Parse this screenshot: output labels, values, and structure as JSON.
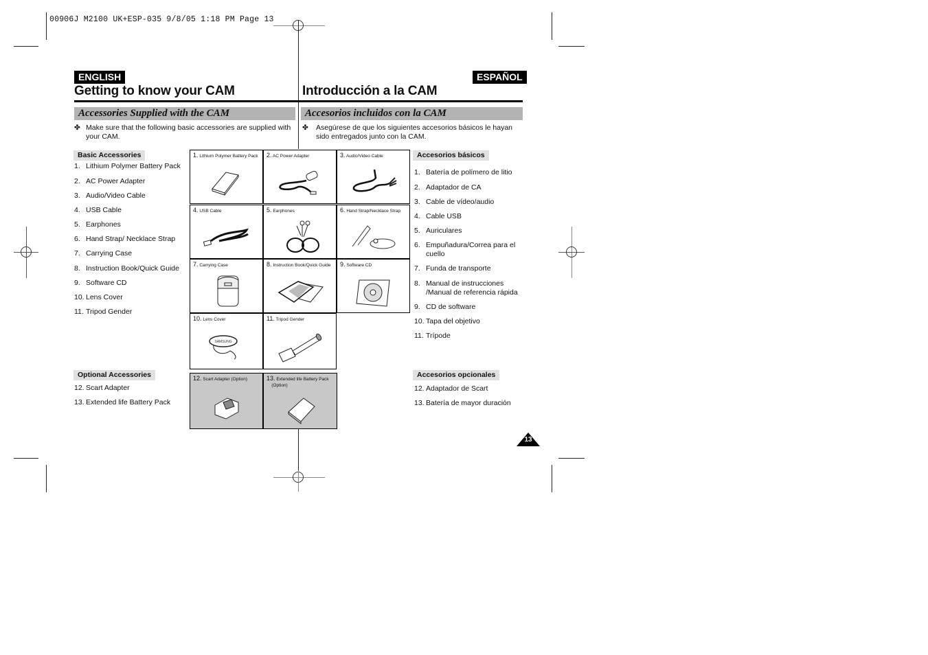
{
  "slug": "00906J M2100 UK+ESP-035  9/8/05 1:18 PM  Page 13",
  "english": {
    "lang_label": "ENGLISH",
    "title": "Getting to know your CAM",
    "section": "Accessories Supplied with the CAM",
    "bullet_icon": "✤",
    "intro_line1": "Make sure that the following basic accessories are supplied with",
    "intro_line2": "your CAM.",
    "basic_heading": "Basic Accessories",
    "basic_items": [
      {
        "num": "1.",
        "label": "Lithium Polymer Battery Pack"
      },
      {
        "num": "2.",
        "label": "AC Power Adapter"
      },
      {
        "num": "3.",
        "label": "Audio/Video Cable"
      },
      {
        "num": "4.",
        "label": "USB Cable"
      },
      {
        "num": "5.",
        "label": "Earphones"
      },
      {
        "num": "6.",
        "label": "Hand Strap/ Necklace Strap"
      },
      {
        "num": "7.",
        "label": "Carrying Case"
      },
      {
        "num": "8.",
        "label": "Instruction Book/Quick Guide"
      },
      {
        "num": "9.",
        "label": "Software CD"
      },
      {
        "num": "10.",
        "label": "Lens Cover"
      },
      {
        "num": "11.",
        "label": "Tripod Gender"
      }
    ],
    "optional_heading": "Optional Accessories",
    "optional_items": [
      {
        "num": "12.",
        "label": "Scart Adapter"
      },
      {
        "num": "13.",
        "label": "Extended life Battery Pack"
      }
    ]
  },
  "spanish": {
    "lang_label": "ESPAÑOL",
    "title": "Introducción a la CAM",
    "section": "Accesorios incluidos con la CAM",
    "bullet_icon": "✤",
    "intro_line1": "Asegúrese de que los siguientes accesorios básicos le hayan",
    "intro_line2": "sido entregados junto con la CAM.",
    "basic_heading": "Accesorios básicos",
    "basic_items": [
      {
        "num": "1.",
        "label": "Batería de polímero de litio"
      },
      {
        "num": "2.",
        "label": "Adaptador de CA"
      },
      {
        "num": "3.",
        "label": "Cable de vídeo/audio"
      },
      {
        "num": "4.",
        "label": "Cable USB"
      },
      {
        "num": "5.",
        "label": "Auriculares"
      },
      {
        "num": "6.",
        "label": "Empuñadura/Correa para el",
        "label2": "cuello"
      },
      {
        "num": "7.",
        "label": "Funda de transporte"
      },
      {
        "num": "8.",
        "label": "Manual de instrucciones",
        "label2": "/Manual de referencia rápida"
      },
      {
        "num": "9.",
        "label": "CD de software"
      },
      {
        "num": "10.",
        "label": "Tapa del objetivo"
      },
      {
        "num": "11.",
        "label": "Trípode"
      }
    ],
    "optional_heading": "Accesorios opcionales",
    "optional_items": [
      {
        "num": "12.",
        "label": "Adaptador de Scart"
      },
      {
        "num": "13.",
        "label": "Batería de mayor duración"
      }
    ]
  },
  "grid": [
    {
      "num": "1.",
      "caption": "Lithium Polymer Battery Pack",
      "icon": "battery-icon"
    },
    {
      "num": "2.",
      "caption": "AC Power Adapter",
      "icon": "power-adapter-icon"
    },
    {
      "num": "3.",
      "caption": "Audio/Video Cable",
      "icon": "av-cable-icon"
    },
    {
      "num": "4.",
      "caption": "USB Cable",
      "icon": "usb-cable-icon"
    },
    {
      "num": "5.",
      "caption": "Earphones",
      "icon": "earphones-icon"
    },
    {
      "num": "6.",
      "caption": "Hand Strap/Necklace Strap",
      "icon": "strap-icon"
    },
    {
      "num": "7.",
      "caption": "Carrying Case",
      "icon": "carrying-case-icon"
    },
    {
      "num": "8.",
      "caption": "Instruction Book/Quick Guide",
      "icon": "book-icon"
    },
    {
      "num": "9.",
      "caption": "Software CD",
      "icon": "cd-icon"
    },
    {
      "num": "10.",
      "caption": "Lens Cover",
      "icon": "lens-cover-icon"
    },
    {
      "num": "11.",
      "caption": "Tripod Gender",
      "icon": "tripod-gender-icon"
    }
  ],
  "optional_grid": [
    {
      "num": "12.",
      "caption": "Scart Adapter (Option)",
      "icon": "scart-adapter-icon"
    },
    {
      "num": "13.",
      "caption": "Extended life Battery Pack",
      "caption2": "(Option)",
      "icon": "battery-icon"
    }
  ],
  "page_number": "13"
}
